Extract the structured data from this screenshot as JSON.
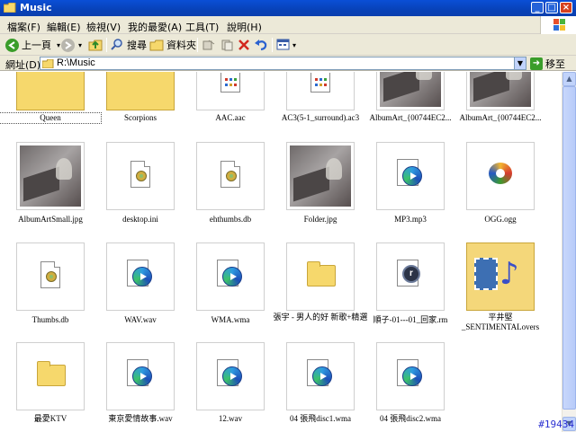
{
  "window": {
    "title": "Music"
  },
  "menu": [
    "檔案(F)",
    "編輯(E)",
    "檢視(V)",
    "我的最愛(A)",
    "工具(T)",
    "說明(H)"
  ],
  "toolbar": {
    "back_label": "上一頁",
    "search_label": "搜尋",
    "folders_label": "資料夾"
  },
  "address": {
    "label": "網址(D)",
    "path": "R:\\Music",
    "go_label": "移至"
  },
  "files": [
    {
      "name": "Queen",
      "icon": "folder-thumbnail"
    },
    {
      "name": "Scorpions",
      "icon": "folder-thumbnail"
    },
    {
      "name": "AAC.aac",
      "icon": "audio-file-icon"
    },
    {
      "name": "AC3(5-1_surround).ac3",
      "icon": "audio-file-icon"
    },
    {
      "name": "AlbumArt_{00744EC2...",
      "icon": "album-art-thumbnail"
    },
    {
      "name": "AlbumArt_{00744EC2...",
      "icon": "album-art-thumbnail"
    },
    {
      "name": "AlbumArtSmall.jpg",
      "icon": "album-art-thumbnail"
    },
    {
      "name": "desktop.ini",
      "icon": "settings-file-icon"
    },
    {
      "name": "ehthumbs.db",
      "icon": "settings-file-icon"
    },
    {
      "name": "Folder.jpg",
      "icon": "album-art-thumbnail"
    },
    {
      "name": "MP3.mp3",
      "icon": "media-player-file-icon"
    },
    {
      "name": "OGG.ogg",
      "icon": "ogg-file-icon"
    },
    {
      "name": "Thumbs.db",
      "icon": "settings-file-icon"
    },
    {
      "name": "WAV.wav",
      "icon": "media-player-file-icon"
    },
    {
      "name": "WMA.wma",
      "icon": "media-player-file-icon"
    },
    {
      "name": "張宇 - 男人的好 新歌+精選",
      "icon": "folder-icon"
    },
    {
      "name": "順子-01---01_回家.rm",
      "icon": "realmedia-file-icon"
    },
    {
      "name": "平井堅 _SENTIMENTALovers",
      "icon": "music-folder-thumbnail"
    },
    {
      "name": "最愛KTV",
      "icon": "folder-icon"
    },
    {
      "name": "東京愛情故事.wav",
      "icon": "media-player-file-icon"
    },
    {
      "name": "12.wav",
      "icon": "media-player-file-icon"
    },
    {
      "name": "04 張飛disc1.wma",
      "icon": "media-player-file-icon"
    },
    {
      "name": "04 張飛disc2.wma",
      "icon": "media-player-file-icon"
    }
  ],
  "watermark": "#19434"
}
